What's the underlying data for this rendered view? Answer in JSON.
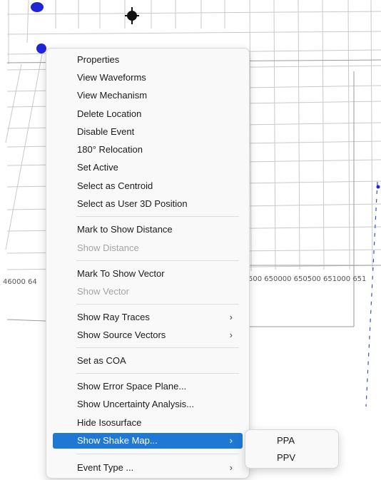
{
  "axis": {
    "left_label": "46000 64",
    "right_label": "500 650000 650500 651000 651"
  },
  "context_menu": {
    "items": [
      {
        "label": "Properties"
      },
      {
        "label": "View Waveforms"
      },
      {
        "label": "View Mechanism"
      },
      {
        "label": "Delete Location"
      },
      {
        "label": "Disable Event"
      },
      {
        "label": "180° Relocation"
      },
      {
        "label": "Set Active"
      },
      {
        "label": "Select as Centroid"
      },
      {
        "label": "Select as User 3D Position"
      },
      {
        "label": "Mark to Show Distance"
      },
      {
        "label": "Show Distance",
        "disabled": true
      },
      {
        "label": "Mark To Show Vector"
      },
      {
        "label": "Show Vector",
        "disabled": true
      },
      {
        "label": "Show Ray Traces",
        "submenu": true
      },
      {
        "label": "Show Source Vectors",
        "submenu": true
      },
      {
        "label": "Set as COA"
      },
      {
        "label": "Show Error Space Plane..."
      },
      {
        "label": "Show Uncertainty Analysis..."
      },
      {
        "label": "Hide Isosurface"
      },
      {
        "label": "Show Shake Map...",
        "submenu": true,
        "highlighted": true
      },
      {
        "label": "Event Type ...",
        "submenu": true
      }
    ],
    "submenu_arrow": "›"
  },
  "shake_map_submenu": {
    "items": [
      {
        "label": "PPA"
      },
      {
        "label": "PPV"
      }
    ]
  },
  "colors": {
    "highlight": "#1e78d4",
    "event_marker": "#1f25d6",
    "dashed_line": "#3a4fc0"
  }
}
